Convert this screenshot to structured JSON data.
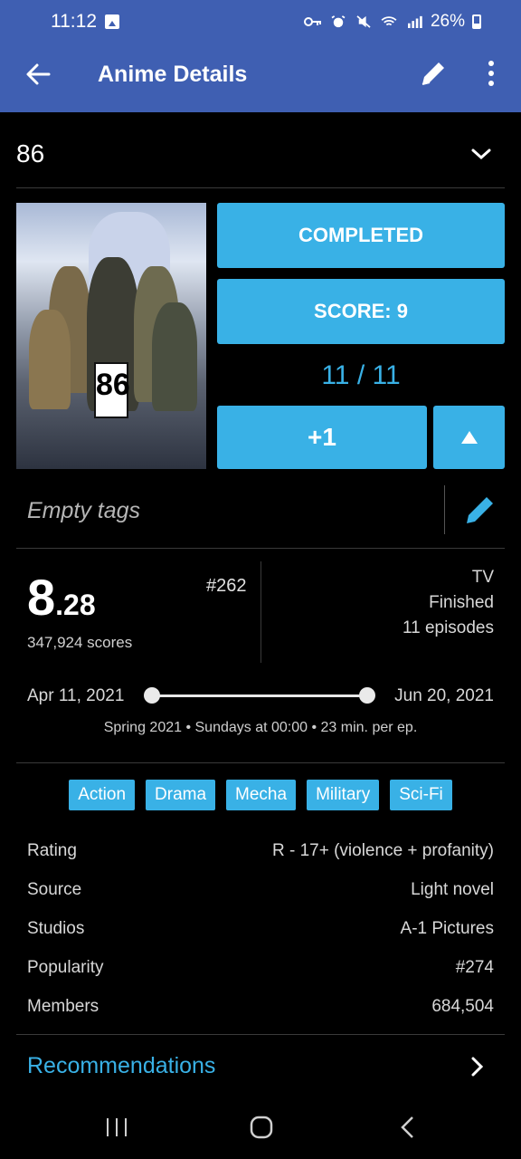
{
  "status_bar": {
    "time": "11:12",
    "battery": "26%"
  },
  "app_bar": {
    "title": "Anime Details"
  },
  "anime": {
    "title": "86",
    "status_button": "COMPLETED",
    "score_button": "SCORE: 9",
    "progress": "11 / 11",
    "increment_button": "+1",
    "poster_text": "86"
  },
  "tags": {
    "placeholder": "Empty tags"
  },
  "stats": {
    "mean_int": "8",
    "mean_dec": ".28",
    "rank": "#262",
    "scored_by": "347,924 scores",
    "media_type": "TV",
    "airing_status": "Finished",
    "episodes": "11 episodes"
  },
  "dates": {
    "start": "Apr 11, 2021",
    "end": "Jun 20, 2021",
    "season_info": "Spring 2021 • Sundays at 00:00 • 23 min. per ep."
  },
  "genres": [
    "Action",
    "Drama",
    "Mecha",
    "Military",
    "Sci-Fi"
  ],
  "details": [
    {
      "key": "Rating",
      "value": "R - 17+ (violence + profanity)"
    },
    {
      "key": "Source",
      "value": "Light novel"
    },
    {
      "key": "Studios",
      "value": "A-1 Pictures"
    },
    {
      "key": "Popularity",
      "value": "#274"
    },
    {
      "key": "Members",
      "value": "684,504"
    }
  ],
  "recommendations": {
    "label": "Recommendations"
  },
  "colors": {
    "appbar": "#3f5fb2",
    "accent": "#39b1e6",
    "background": "#000000"
  }
}
